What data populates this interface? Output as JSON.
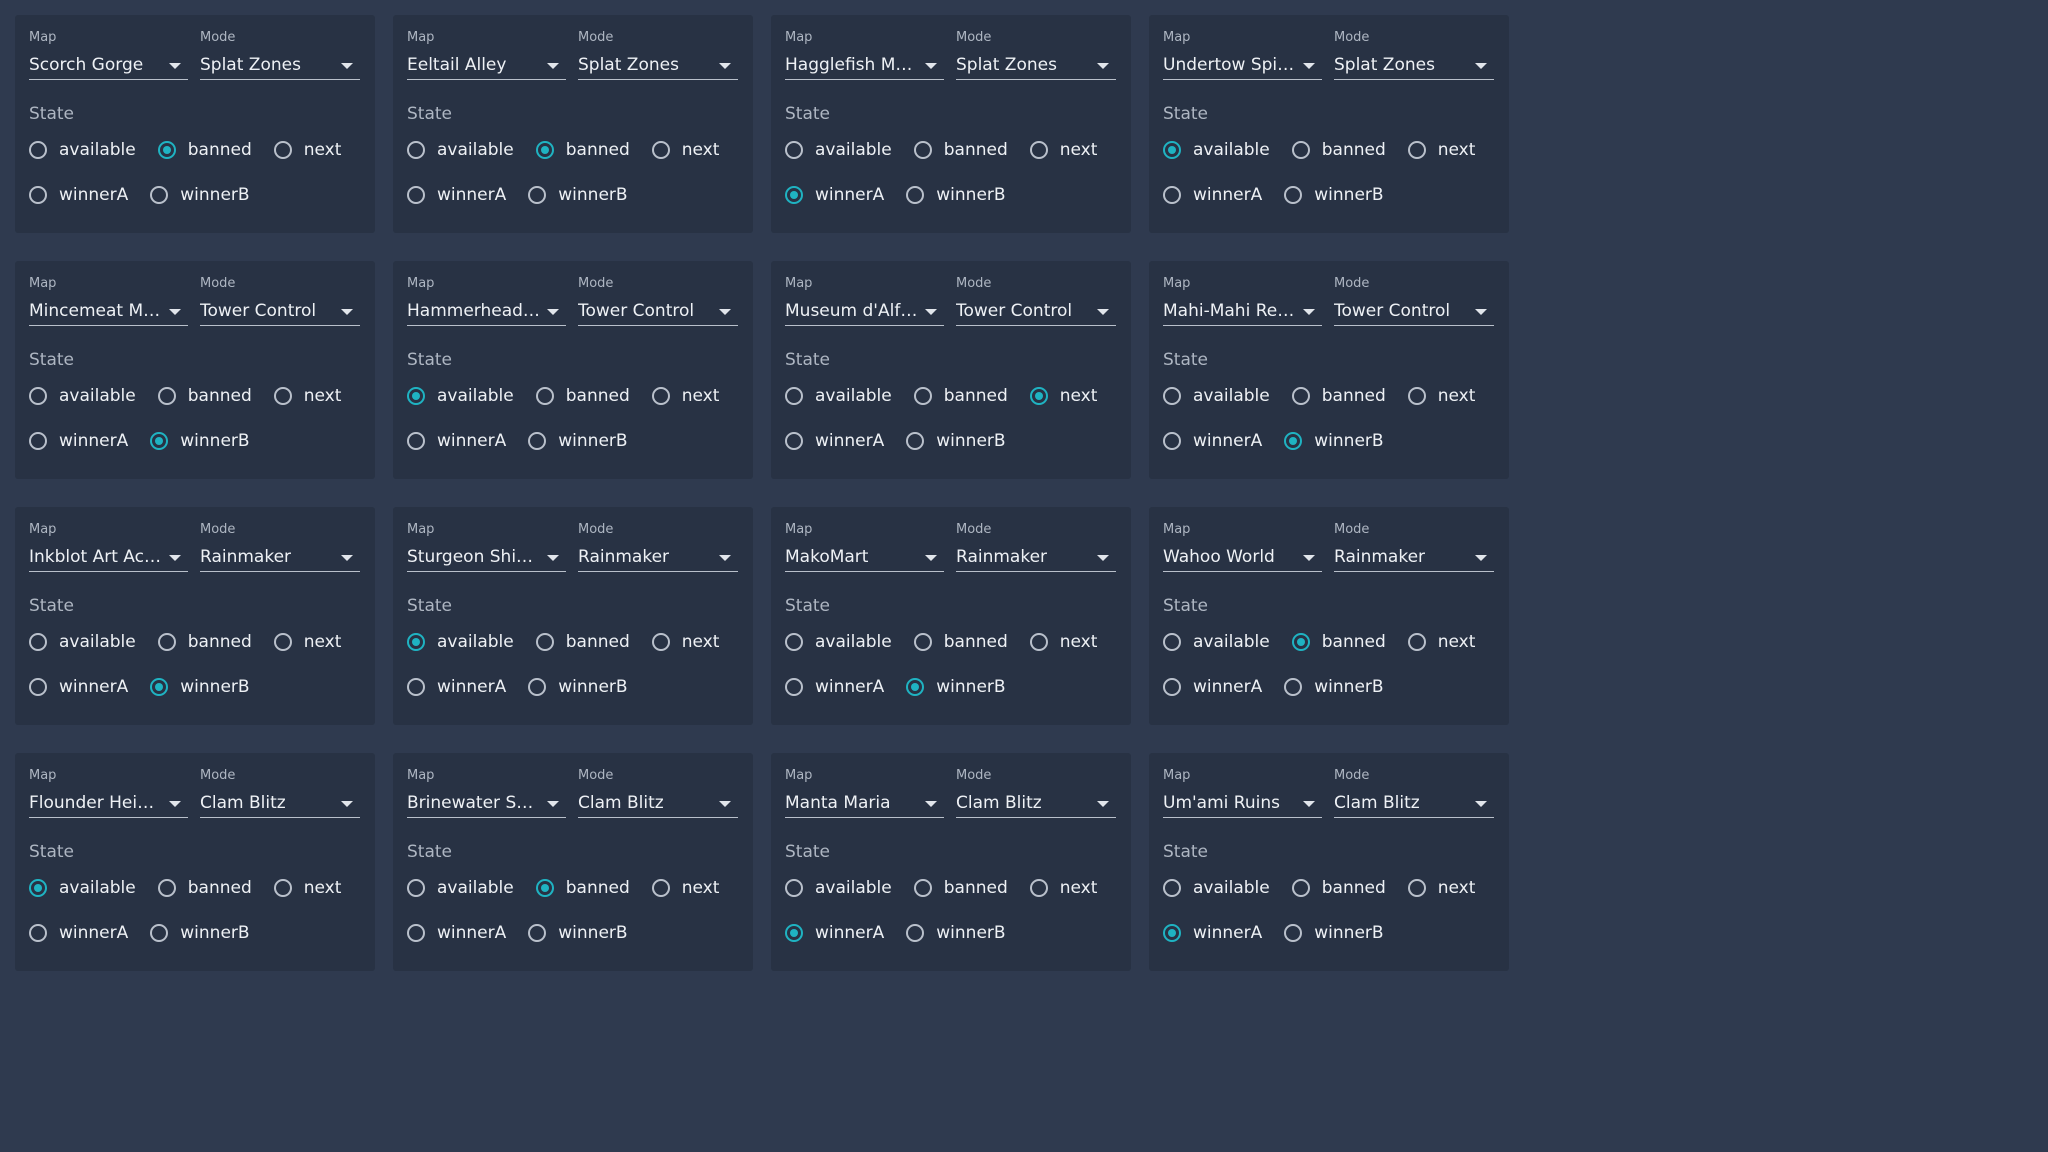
{
  "labels": {
    "map": "Map",
    "mode": "Mode",
    "state": "State"
  },
  "states": [
    "available",
    "banned",
    "next",
    "winnerA",
    "winnerB"
  ],
  "accent_color": "#1fb3c2",
  "cards": [
    {
      "map": "Scorch Gorge",
      "mode": "Splat Zones",
      "state": "banned"
    },
    {
      "map": "Eeltail Alley",
      "mode": "Splat Zones",
      "state": "banned"
    },
    {
      "map": "Hagglefish Market",
      "mode": "Splat Zones",
      "state": "winnerA"
    },
    {
      "map": "Undertow Spillway",
      "mode": "Splat Zones",
      "state": "available"
    },
    {
      "map": "Mincemeat Metalworks",
      "mode": "Tower Control",
      "state": "winnerB"
    },
    {
      "map": "Hammerhead Bridge",
      "mode": "Tower Control",
      "state": "available"
    },
    {
      "map": "Museum d'Alfonsino",
      "mode": "Tower Control",
      "state": "next"
    },
    {
      "map": "Mahi-Mahi Resort",
      "mode": "Tower Control",
      "state": "winnerB"
    },
    {
      "map": "Inkblot Art Academy",
      "mode": "Rainmaker",
      "state": "winnerB"
    },
    {
      "map": "Sturgeon Shipyard",
      "mode": "Rainmaker",
      "state": "available"
    },
    {
      "map": "MakoMart",
      "mode": "Rainmaker",
      "state": "winnerB"
    },
    {
      "map": "Wahoo World",
      "mode": "Rainmaker",
      "state": "banned"
    },
    {
      "map": "Flounder Heights",
      "mode": "Clam Blitz",
      "state": "available"
    },
    {
      "map": "Brinewater Springs",
      "mode": "Clam Blitz",
      "state": "banned"
    },
    {
      "map": "Manta Maria",
      "mode": "Clam Blitz",
      "state": "winnerA"
    },
    {
      "map": "Um'ami Ruins",
      "mode": "Clam Blitz",
      "state": "winnerA"
    }
  ]
}
